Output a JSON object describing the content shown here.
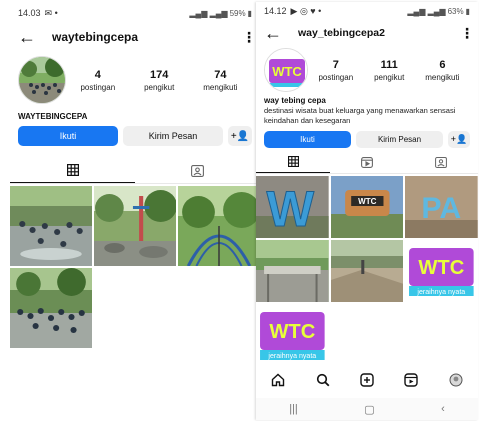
{
  "left_phone": {
    "status": {
      "time": "14.03",
      "battery": "59%"
    },
    "username": "waytebingcepa",
    "stats": [
      {
        "value": "4",
        "label": "postingan"
      },
      {
        "value": "174",
        "label": "pengikut"
      },
      {
        "value": "74",
        "label": "mengikuti"
      }
    ],
    "display_name": "WAYTEBINGCEPA",
    "follow_label": "Ikuti",
    "message_label": "Kirim Pesan"
  },
  "right_phone": {
    "status": {
      "time": "14.12",
      "battery": "63%"
    },
    "username": "way_tebingcepa2",
    "stats": [
      {
        "value": "7",
        "label": "postingan"
      },
      {
        "value": "111",
        "label": "pengikut"
      },
      {
        "value": "6",
        "label": "mengikuti"
      }
    ],
    "display_name": "way tebing cepa",
    "bio": "destinasi wisata buat keluarga yang menawarkan sensasi keindahan dan kesegaran",
    "follow_label": "Ikuti",
    "message_label": "Kirim Pesan",
    "post_texts": {
      "wtc": "WTC",
      "tagline": "jeraihnya nyata",
      "pa": "PA"
    }
  },
  "colors": {
    "accent": "#1877f2",
    "button_gray": "#efefef"
  },
  "icons": [
    "back-arrow-icon",
    "more-vert-icon",
    "add-person-icon",
    "grid-icon",
    "tagged-icon",
    "reels-icon",
    "home-icon",
    "search-icon",
    "create-icon",
    "profile-icon"
  ]
}
